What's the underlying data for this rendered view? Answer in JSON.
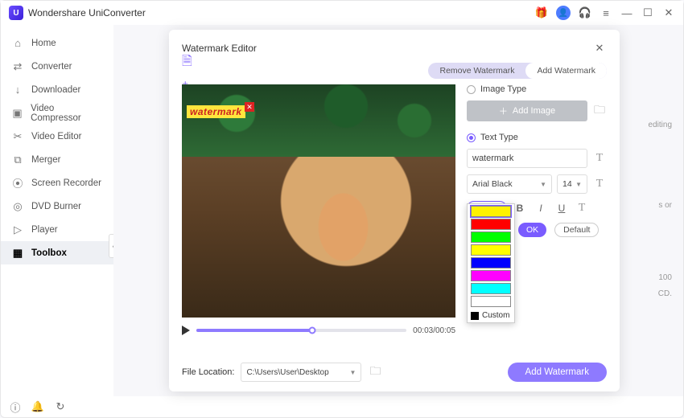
{
  "app": {
    "title": "Wondershare UniConverter"
  },
  "sidebar": {
    "items": [
      {
        "label": "Home",
        "icon": "home"
      },
      {
        "label": "Converter",
        "icon": "convert"
      },
      {
        "label": "Downloader",
        "icon": "download"
      },
      {
        "label": "Video Compressor",
        "icon": "compress"
      },
      {
        "label": "Video Editor",
        "icon": "scissors"
      },
      {
        "label": "Merger",
        "icon": "merge"
      },
      {
        "label": "Screen Recorder",
        "icon": "record"
      },
      {
        "label": "DVD Burner",
        "icon": "disc"
      },
      {
        "label": "Player",
        "icon": "play"
      },
      {
        "label": "Toolbox",
        "icon": "grid"
      }
    ]
  },
  "bg": {
    "l1": "editing",
    "l2": "s or",
    "l3": "100",
    "l4": "CD."
  },
  "modal": {
    "title": "Watermark Editor",
    "tabs": {
      "remove": "Remove Watermark",
      "add": "Add Watermark"
    },
    "watermark_text": "watermark",
    "image_type_label": "Image Type",
    "text_type_label": "Text Type",
    "add_image_label": "Add Image",
    "text_value": "watermark",
    "font_family": "Arial Black",
    "font_size": "14",
    "ok_label": "OK",
    "default_label": "Default",
    "custom_label": "Custom",
    "timecode": "00:03/00:05",
    "file_location_label": "File Location:",
    "file_location_value": "C:\\Users\\User\\Desktop",
    "add_watermark_btn": "Add Watermark"
  },
  "colors": {
    "selected": "#fff200",
    "palette": [
      "#fff200",
      "#ff0000",
      "#00ff00",
      "#ffff00",
      "#0000ff",
      "#ff00ff",
      "#00ffff",
      "#ffffff"
    ]
  }
}
